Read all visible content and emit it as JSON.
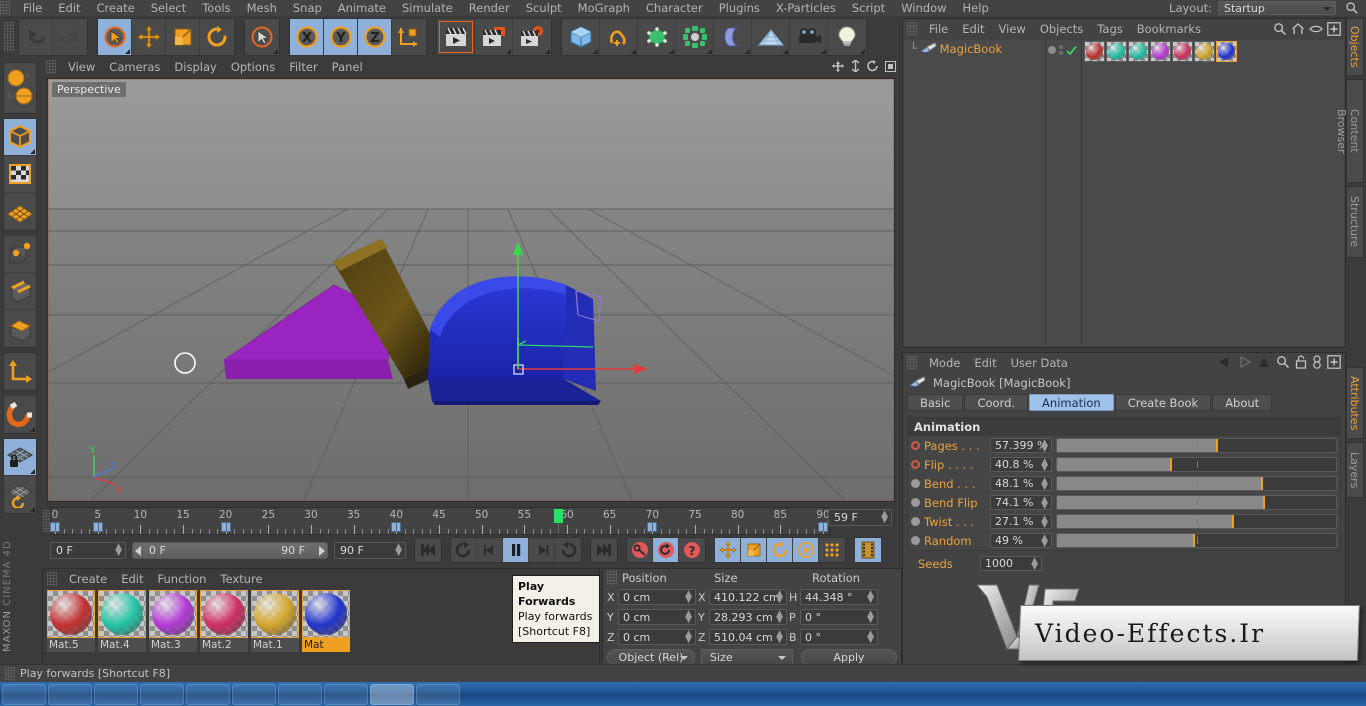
{
  "app": {
    "brand_line1": "MAXON",
    "brand_line2": "CINEMA 4D"
  },
  "top_menu": {
    "items": [
      "File",
      "Edit",
      "Create",
      "Select",
      "Tools",
      "Mesh",
      "Snap",
      "Animate",
      "Simulate",
      "Render",
      "Sculpt",
      "MoGraph",
      "Character",
      "Plugins",
      "X-Particles",
      "Script",
      "Window",
      "Help"
    ],
    "layout_label": "Layout:",
    "layout_value": "Startup",
    "search_icon": "search-icon"
  },
  "main_toolbar": {
    "groups": [
      {
        "name": "history",
        "buttons": [
          {
            "name": "undo-button",
            "icon": "undo-icon",
            "active": false
          },
          {
            "name": "redo-button",
            "icon": "redo-icon",
            "active": false
          }
        ]
      },
      {
        "name": "tools",
        "buttons": [
          {
            "name": "live-selection-tool",
            "icon": "cursor-circle-icon",
            "active": true
          },
          {
            "name": "move-tool",
            "icon": "move-arrows-icon",
            "active": false
          },
          {
            "name": "scale-tool",
            "icon": "scale-box-icon",
            "active": false
          },
          {
            "name": "rotate-tool",
            "icon": "rotate-icon",
            "active": false
          }
        ]
      },
      {
        "name": "selection",
        "buttons": [
          {
            "name": "selection-mode-button",
            "icon": "cursor-circle-icon",
            "active": false
          }
        ]
      },
      {
        "name": "axis-locks",
        "buttons": [
          {
            "name": "x-axis-lock",
            "icon": "x-axis-icon",
            "active": true
          },
          {
            "name": "y-axis-lock",
            "icon": "y-axis-icon",
            "active": true
          },
          {
            "name": "z-axis-lock",
            "icon": "z-axis-icon",
            "active": true
          },
          {
            "name": "world-object-coordinate-toggle",
            "icon": "world-axis-icon",
            "active": false
          }
        ]
      },
      {
        "name": "render",
        "buttons": [
          {
            "name": "render-view-button",
            "icon": "clapperboard-icon",
            "active": false
          },
          {
            "name": "render-to-picture-viewer-button",
            "icon": "clapperboard-window-icon",
            "active": false
          },
          {
            "name": "render-settings-button",
            "icon": "clapperboard-gear-icon",
            "active": false
          }
        ]
      },
      {
        "name": "create",
        "buttons": [
          {
            "name": "add-cube-button",
            "icon": "cube-icon",
            "active": false
          },
          {
            "name": "add-spline-button",
            "icon": "spline-icon",
            "active": false
          },
          {
            "name": "add-nurbs-button",
            "icon": "nurbs-icon",
            "active": false
          },
          {
            "name": "add-array-button",
            "icon": "array-icon",
            "active": false
          },
          {
            "name": "add-bend-deformer-button",
            "icon": "bend-icon",
            "active": false
          },
          {
            "name": "add-floor-button",
            "icon": "floor-icon",
            "active": false
          },
          {
            "name": "add-camera-button",
            "icon": "camera-icon",
            "active": false
          },
          {
            "name": "add-light-button",
            "icon": "light-bulb-icon",
            "active": false
          }
        ]
      }
    ]
  },
  "left_toolbar": {
    "buttons": [
      {
        "name": "model-mode-button",
        "icon": "cube-model-icon",
        "active": true
      },
      {
        "name": "texture-mode-button",
        "icon": "checker-texture-icon",
        "active": false
      },
      {
        "name": "deformer-mode-button",
        "icon": "deformer-grid-icon",
        "active": false
      },
      {
        "name": "points-mode-button",
        "icon": "points-icon",
        "active": false
      },
      {
        "name": "edges-mode-button",
        "icon": "edges-icon",
        "active": false
      },
      {
        "name": "polygons-mode-button",
        "icon": "polygons-icon",
        "active": false
      },
      {
        "name": "axis-mode-button",
        "icon": "axis-icon",
        "active": false
      },
      {
        "name": "enable-snap-button",
        "icon": "magnet-icon",
        "active": false
      },
      {
        "name": "workplane-lock-button",
        "icon": "workplane-lock-icon",
        "active": true
      },
      {
        "name": "workplane-reset-button",
        "icon": "workplane-reset-icon",
        "active": false
      }
    ]
  },
  "viewport": {
    "menu": [
      "View",
      "Cameras",
      "Display",
      "Options",
      "Filter",
      "Panel"
    ],
    "label": "Perspective",
    "axis_labels": {
      "x": "X",
      "y": "Y",
      "z": "Z"
    },
    "corner_icons": [
      "pan-icon",
      "zoom-icon",
      "rotate-icon",
      "maximize-icon"
    ]
  },
  "object_manager": {
    "menu": [
      "File",
      "Edit",
      "View",
      "Objects",
      "Tags",
      "Bookmarks"
    ],
    "icons": [
      "search-icon",
      "home-icon",
      "eye-icon",
      "expand-icon"
    ],
    "panel_tab": "Objects",
    "object": {
      "name": "MagicBook",
      "icon": "plugin-object-icon",
      "visibility_dot": "visibility-dot",
      "enabled_check": "check-icon",
      "tags": [
        {
          "name": "material-tag-red",
          "color": "#c03030",
          "selected": false
        },
        {
          "name": "material-tag-teal",
          "color": "#22bfa4",
          "selected": false
        },
        {
          "name": "material-tag-teal-2",
          "color": "#22bfa4",
          "selected": false
        },
        {
          "name": "material-tag-magenta",
          "color": "#b83ad0",
          "selected": false
        },
        {
          "name": "material-tag-pink",
          "color": "#cf2f63",
          "selected": false
        },
        {
          "name": "material-tag-gold",
          "color": "#d4a72b",
          "selected": false
        },
        {
          "name": "material-tag-blue",
          "color": "#2235cf",
          "selected": true
        }
      ]
    }
  },
  "attributes": {
    "menu": [
      "Mode",
      "Edit",
      "User Data"
    ],
    "icons": [
      "back-arrow-icon",
      "forward-arrow-icon",
      "up-arrow-icon",
      "search-icon",
      "lock-icon",
      "pin-icon",
      "expand-icon"
    ],
    "panel_tabs": [
      "Attributes",
      "Layers"
    ],
    "active_panel_tab": "Attributes",
    "title": "MagicBook [MagicBook]",
    "tabs": [
      {
        "label": "Basic",
        "active": false
      },
      {
        "label": "Coord.",
        "active": false
      },
      {
        "label": "Animation",
        "active": true
      },
      {
        "label": "Create Book",
        "active": false
      },
      {
        "label": "About",
        "active": false
      }
    ],
    "section_title": "Animation",
    "params": [
      {
        "name": "pages-parameter",
        "label": "Pages . . .",
        "value": "57.399 %",
        "percent": 57.399,
        "led": "red-ring"
      },
      {
        "name": "flip-parameter",
        "label": "Flip  . . . .",
        "value": "40.8 %",
        "percent": 40.8,
        "led": "red-ring"
      },
      {
        "name": "bend-parameter",
        "label": "Bend . . .",
        "value": "48.1 %",
        "percent": 73.5,
        "led": "grey-dot"
      },
      {
        "name": "bend-flip-parameter",
        "label": "Bend Flip",
        "value": "74.1 %",
        "percent": 74.1,
        "led": "grey-dot"
      },
      {
        "name": "twist-parameter",
        "label": "Twist  . . .",
        "value": "27.1 %",
        "percent": 63.0,
        "led": "grey-dot"
      },
      {
        "name": "random-parameter",
        "label": "Random",
        "value": "49 %",
        "percent": 49.0,
        "led": "grey-dot"
      }
    ],
    "seeds": {
      "name": "seeds-parameter",
      "label": "Seeds",
      "value": "1000"
    }
  },
  "timeline": {
    "ruler_labels": [
      "0",
      "5",
      "10",
      "15",
      "20",
      "25",
      "30",
      "35",
      "40",
      "45",
      "50",
      "55",
      "60",
      "65",
      "70",
      "75",
      "80",
      "85",
      "90"
    ],
    "ruler_min": 0,
    "ruler_max": 90,
    "keyframes": [
      0,
      5,
      20,
      40,
      70,
      90
    ],
    "playhead_frame": 59,
    "current_frame_field": "59 F",
    "start_frame_field": "0 F",
    "range_start": "0 F",
    "range_end": "90 F",
    "end_frame_field": "90 F",
    "transport_buttons": [
      {
        "name": "go-to-start-button",
        "icon": "skip-start-icon",
        "active": false
      },
      {
        "name": "play-backwards-loop-button",
        "icon": "loop-back-icon",
        "active": false
      },
      {
        "name": "step-back-button",
        "icon": "step-back-icon",
        "active": false
      },
      {
        "name": "pause-button",
        "icon": "pause-icon",
        "active": true
      },
      {
        "name": "step-forward-button",
        "icon": "step-forward-icon",
        "active": false
      },
      {
        "name": "play-forwards-button",
        "icon": "play-loop-icon",
        "active": false
      },
      {
        "name": "go-to-end-button",
        "icon": "skip-end-icon",
        "active": false
      },
      {
        "name": "record-active-objects-button",
        "icon": "key-icon",
        "active": false
      },
      {
        "name": "autokeying-button",
        "icon": "autokey-icon",
        "active": true
      },
      {
        "name": "keyframe-selection-button",
        "icon": "question-icon",
        "active": false
      },
      {
        "name": "position-key-button",
        "icon": "move-arrows-icon",
        "active": true
      },
      {
        "name": "scale-key-button",
        "icon": "scale-box-icon",
        "active": true
      },
      {
        "name": "rotation-key-button",
        "icon": "rotate-icon",
        "active": true
      },
      {
        "name": "parameter-key-button",
        "icon": "parameter-p-icon",
        "active": true
      },
      {
        "name": "point-level-animation-button",
        "icon": "pla-dots-icon",
        "active": false
      },
      {
        "name": "timeline-button",
        "icon": "filmstrip-icon",
        "active": true
      }
    ]
  },
  "materials": {
    "menu": [
      "Create",
      "Edit",
      "Function",
      "Texture"
    ],
    "items": [
      {
        "name": "material-mat5",
        "label": "Mat.5",
        "color": "#c23232",
        "selected": false
      },
      {
        "name": "material-mat4",
        "label": "Mat.4",
        "color": "#24c4a7",
        "selected": false
      },
      {
        "name": "material-mat3",
        "label": "Mat.3",
        "color": "#b23ad4",
        "selected": false
      },
      {
        "name": "material-mat2",
        "label": "Mat.2",
        "color": "#cd2e60",
        "selected": false
      },
      {
        "name": "material-mat1",
        "label": "Mat.1",
        "color": "#d3a62c",
        "selected": false
      },
      {
        "name": "material-mat",
        "label": "Mat",
        "color": "#2234cc",
        "selected": true
      }
    ]
  },
  "coordinates": {
    "headers": [
      "Position",
      "Size",
      "Rotation"
    ],
    "rows": [
      {
        "pos_axis": "X",
        "pos_value": "0 cm",
        "size_axis": "X",
        "size_value": "410.122 cm",
        "rot_axis": "H",
        "rot_value": "44.348 °"
      },
      {
        "pos_axis": "Y",
        "pos_value": "0 cm",
        "size_axis": "Y",
        "size_value": "28.293 cm",
        "rot_axis": "P",
        "rot_value": "0 °"
      },
      {
        "pos_axis": "Z",
        "pos_value": "0 cm",
        "size_axis": "Z",
        "size_value": "510.04 cm",
        "rot_axis": "B",
        "rot_value": "0 °"
      }
    ],
    "coord_system": "Object (Rel)",
    "size_mode": "Size",
    "apply_label": "Apply"
  },
  "tooltip": {
    "title": "Play Forwards",
    "description": "Play forwards",
    "shortcut": "[Shortcut F8]"
  },
  "status_bar": {
    "text": "Play forwards [Shortcut F8]"
  },
  "watermark": {
    "logo": "VE",
    "text": "Video-Effects.Ir"
  },
  "colors": {
    "accent_orange": "#e8a33d",
    "selection_blue": "#8fb0d8",
    "panel_bg": "#434343",
    "app_bg": "#3b3b3b",
    "slider_mark": "#f0a020"
  }
}
